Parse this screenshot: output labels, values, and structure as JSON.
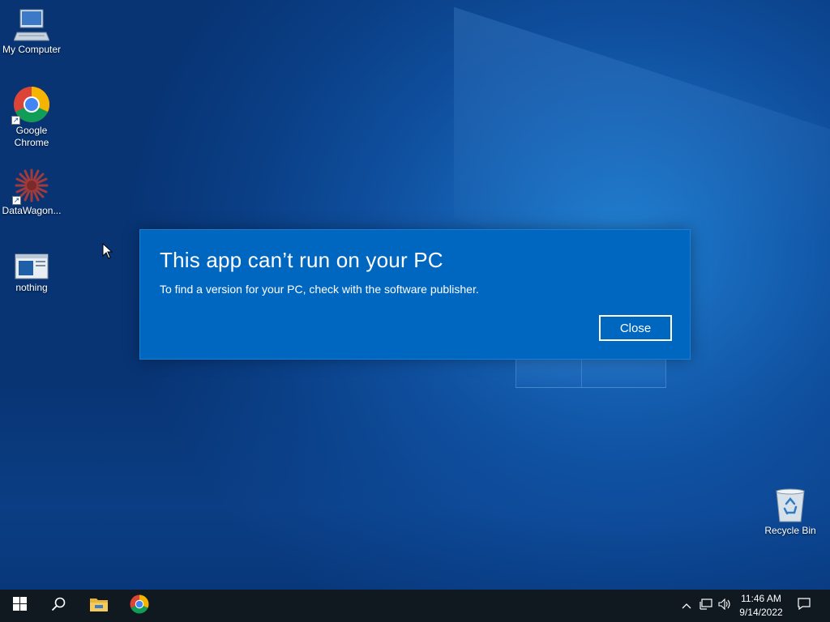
{
  "desktop": {
    "icons": [
      {
        "label": "My Computer",
        "icon": "computer-icon"
      },
      {
        "label": "Google Chrome",
        "icon": "chrome-icon"
      },
      {
        "label": "DataWagon...",
        "icon": "datawagon-icon"
      },
      {
        "label": "nothing",
        "icon": "window-file-icon"
      },
      {
        "label": "Recycle Bin",
        "icon": "recycle-bin-icon"
      }
    ]
  },
  "dialog": {
    "title": "This app can’t run on your PC",
    "message": "To find a version for your PC, check with the software publisher.",
    "close_label": "Close",
    "background_color": "#0067c0"
  },
  "taskbar": {
    "items": [
      "start-icon",
      "search-icon",
      "file-explorer-icon",
      "chrome-icon"
    ],
    "tray": [
      "chevron-up-icon",
      "network-icon",
      "volume-icon",
      "notification-icon"
    ],
    "time": "11:46 AM",
    "date": "9/14/2022"
  }
}
